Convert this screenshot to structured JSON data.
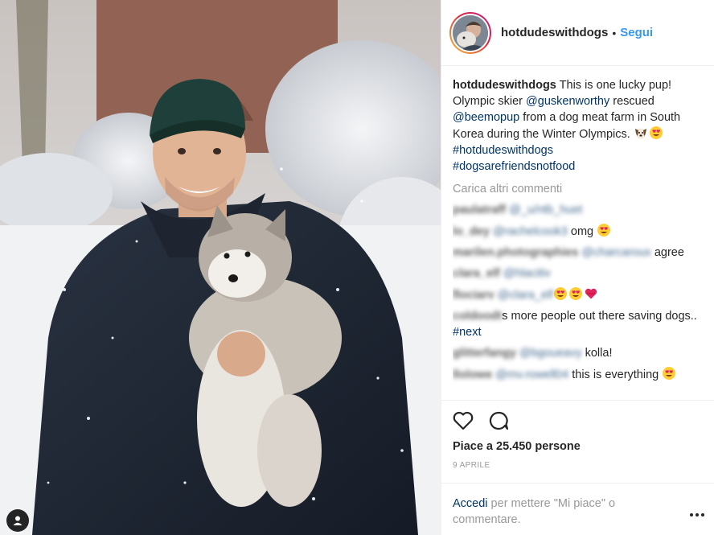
{
  "post": {
    "username": "hotdudeswithdogs",
    "separator": "•",
    "follow_label": "Segui",
    "caption": {
      "username": "hotdudeswithdogs",
      "part1": " This is one lucky pup! Olympic skier ",
      "mention1": "@guskenworthy",
      "part2": " rescued ",
      "mention2": "@beemopup",
      "part3": " from a dog meat farm in South Korea during the Winter Olympics. ",
      "hashtag1": "#hotdudeswithdogs",
      "hashtag2": "#dogsarefriendsnotfood"
    },
    "load_more": "Carica altri commenti",
    "comments": [
      {
        "user": "paulatraff",
        "mention": "@_u/ntb_huet",
        "text": ""
      },
      {
        "user": "lo_dey",
        "mention": "@rachelcook3",
        "text": " omg "
      },
      {
        "user": "marilen.photographies",
        "mention": "@charcaroux",
        "text": " agree"
      },
      {
        "user": "clara_elf",
        "mention": "@hlacitiv",
        "text": ""
      },
      {
        "user": "flociarv",
        "mention": "@clara_elf",
        "text": ""
      },
      {
        "user": "coldoodt",
        "mention": "",
        "text": "s more people out there saving dogs.. ",
        "hashtag": "#next"
      },
      {
        "user": "glitterfangy",
        "mention": "@bgoueavy",
        "text": " kolla!"
      },
      {
        "user": "llolowe",
        "mention": "@mv.rowell04",
        "text": " this is everything "
      }
    ],
    "likes": "Piace a 25.450 persone",
    "date": "9 APRILE",
    "login": {
      "link": "Accedi",
      "text": " per mettere \"Mi piace\" o commentare."
    },
    "icons": {
      "like": "heart-outline-icon",
      "comment": "comment-bubble-icon",
      "more": "more-options-icon",
      "user_tag": "user-tag-icon"
    },
    "colors": {
      "link": "#003569",
      "follow": "#3897f0",
      "muted": "#999999"
    }
  }
}
